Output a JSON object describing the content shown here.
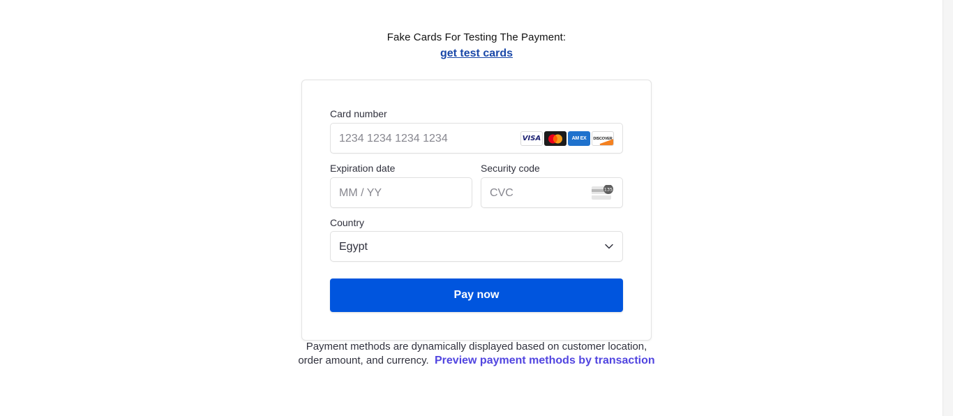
{
  "header": {
    "title": "Fake Cards For Testing The Payment:",
    "link_label": "get test cards"
  },
  "form": {
    "card_number": {
      "label": "Card number",
      "placeholder": "1234 1234 1234 1234",
      "brands": [
        {
          "name": "visa",
          "text": "VISA"
        },
        {
          "name": "mastercard",
          "text": ""
        },
        {
          "name": "amex",
          "text": "AM EX"
        },
        {
          "name": "discover",
          "text": "DISCOVER"
        }
      ]
    },
    "expiration": {
      "label": "Expiration date",
      "placeholder": "MM / YY"
    },
    "security": {
      "label": "Security code",
      "placeholder": "CVC",
      "icon_badge": "135"
    },
    "country": {
      "label": "Country",
      "value": "Egypt"
    },
    "pay_button": "Pay now"
  },
  "footer": {
    "text": "Payment methods are dynamically displayed based on customer location, order amount, and currency.",
    "link_label": "Preview payment methods by transaction"
  },
  "colors": {
    "accent": "#0055de",
    "link": "#1a48a8",
    "footer_link": "#5145e0"
  }
}
